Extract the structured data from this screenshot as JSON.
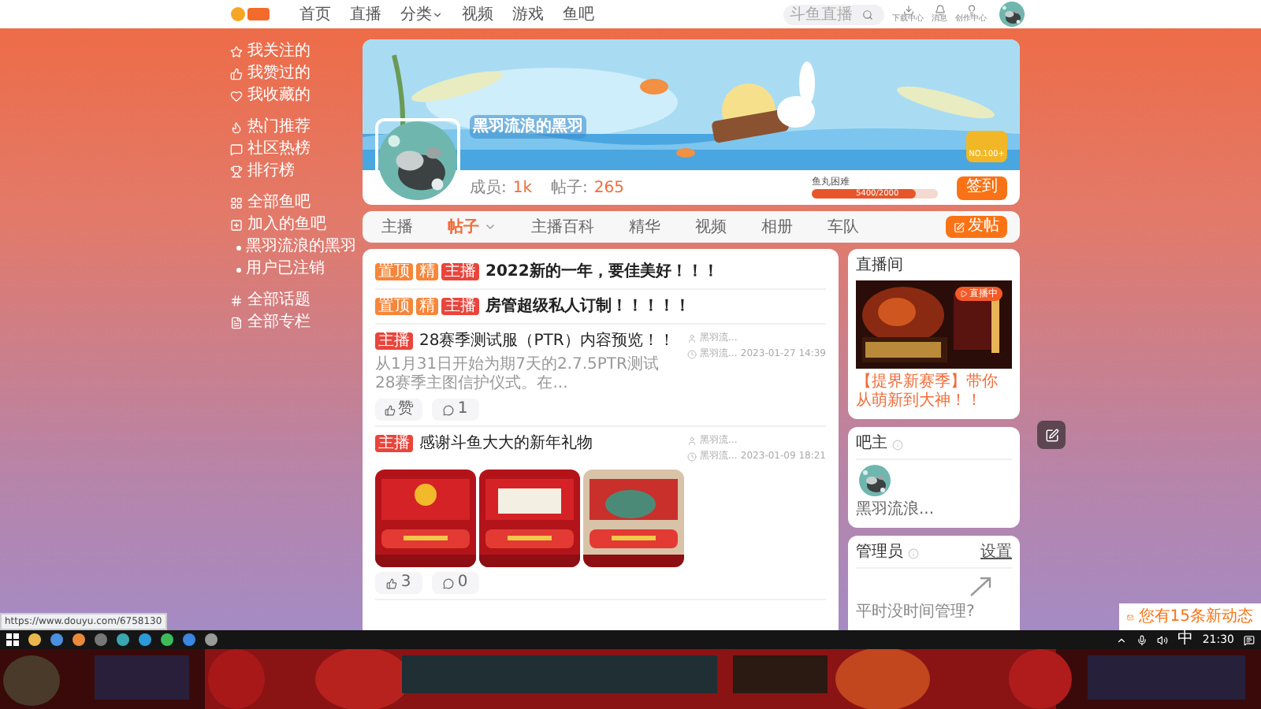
{
  "nav": {
    "links": [
      {
        "label": "首页",
        "dropdown": false
      },
      {
        "label": "直播",
        "dropdown": false
      },
      {
        "label": "分类",
        "dropdown": true
      },
      {
        "label": "视频",
        "dropdown": false
      },
      {
        "label": "游戏",
        "dropdown": false
      },
      {
        "label": "鱼吧",
        "dropdown": false
      }
    ],
    "search": {
      "placeholder": "斗鱼直播"
    },
    "tools": [
      {
        "label": "下载中心"
      },
      {
        "label": "消息"
      },
      {
        "label": "创作中心"
      }
    ]
  },
  "sidebar": {
    "groups": [
      {
        "items": [
          {
            "label": "我关注的",
            "kind": "link"
          },
          {
            "label": "我赞过的",
            "kind": "link"
          },
          {
            "label": "我收藏的",
            "kind": "link"
          }
        ]
      },
      {
        "items": [
          {
            "label": "热门推荐",
            "kind": "link"
          },
          {
            "label": "社区热榜",
            "kind": "link"
          },
          {
            "label": "排行榜",
            "kind": "link"
          }
        ]
      },
      {
        "items": [
          {
            "label": "全部鱼吧",
            "kind": "link"
          },
          {
            "label": "加入的鱼吧",
            "kind": "link"
          },
          {
            "label": "黑羽流浪的黑羽",
            "kind": "sub"
          },
          {
            "label": "用户已注销",
            "kind": "sub"
          }
        ]
      },
      {
        "items": [
          {
            "label": "全部话题",
            "kind": "link"
          },
          {
            "label": "全部专栏",
            "kind": "link"
          }
        ]
      }
    ]
  },
  "banner": {
    "name": "黑羽流浪的黑羽",
    "rank": "NO.100+",
    "members_label": "成员:",
    "members": "1k",
    "posts_label": "帖子:",
    "posts": "265",
    "exp": {
      "label": "鱼丸困难",
      "reading": "5400/2000",
      "level": 0.82
    },
    "sign_button": "签到"
  },
  "tabs": [
    {
      "label": "主播",
      "selected": false,
      "dropdown": false
    },
    {
      "label": "帖子",
      "selected": true,
      "dropdown": true
    },
    {
      "label": "主播百科",
      "selected": false,
      "dropdown": false
    },
    {
      "label": "精华",
      "selected": false,
      "dropdown": false
    },
    {
      "label": "视频",
      "selected": false,
      "dropdown": false
    },
    {
      "label": "相册",
      "selected": false,
      "dropdown": false
    },
    {
      "label": "车队",
      "selected": false,
      "dropdown": false
    }
  ],
  "post_button": "发帖",
  "posts": [
    {
      "tags": [
        {
          "label": "置顶",
          "color": "#f5863a"
        },
        {
          "label": "精",
          "color": "#f5863a"
        },
        {
          "label": "主播",
          "color": "#e8453c"
        }
      ],
      "title": "2022新的一年，要佳美好！！！",
      "bold": true
    },
    {
      "tags": [
        {
          "label": "置顶",
          "color": "#f5863a"
        },
        {
          "label": "精",
          "color": "#f5863a"
        },
        {
          "label": "主播",
          "color": "#e8453c"
        }
      ],
      "title": "房管超级私人订制！！！！！",
      "bold": true
    },
    {
      "tags": [
        {
          "label": "主播",
          "color": "#e8453c"
        }
      ],
      "title": "28赛季测试服（PTR）内容预览！！",
      "bold": false,
      "excerpt": "从1月31日开始为期7天的2.7.5PTR测试 28赛季主图信护仪式。在...",
      "author": "黑羽流...",
      "replier": "黑羽流...",
      "time": "2023-01-27 14:39",
      "likes": "赞",
      "comments": "1"
    },
    {
      "tags": [
        {
          "label": "主播",
          "color": "#e8453c"
        }
      ],
      "title": "感谢斗鱼大大的新年礼物",
      "bold": false,
      "author": "黑羽流...",
      "replier": "黑羽流...",
      "time": "2023-01-09 18:21",
      "images": [
        {
          "kind": "picture"
        },
        {
          "kind": "picture"
        },
        {
          "kind": "picture"
        }
      ],
      "likes": "3",
      "comments": "0"
    }
  ],
  "live": {
    "title": "直播间",
    "badge": "直播中",
    "caption": "【提界新赛季】带你从萌新到大神！！"
  },
  "owner": {
    "title": "吧主",
    "name": "黑羽流浪..."
  },
  "admins": {
    "title": "管理员",
    "action": "设置",
    "note": "平时没时间管理?"
  },
  "notification": "您有15条新动态",
  "status_url": "https://www.douyu.com/6758130",
  "taskbar": {
    "ime": "中",
    "time": "21:30"
  }
}
